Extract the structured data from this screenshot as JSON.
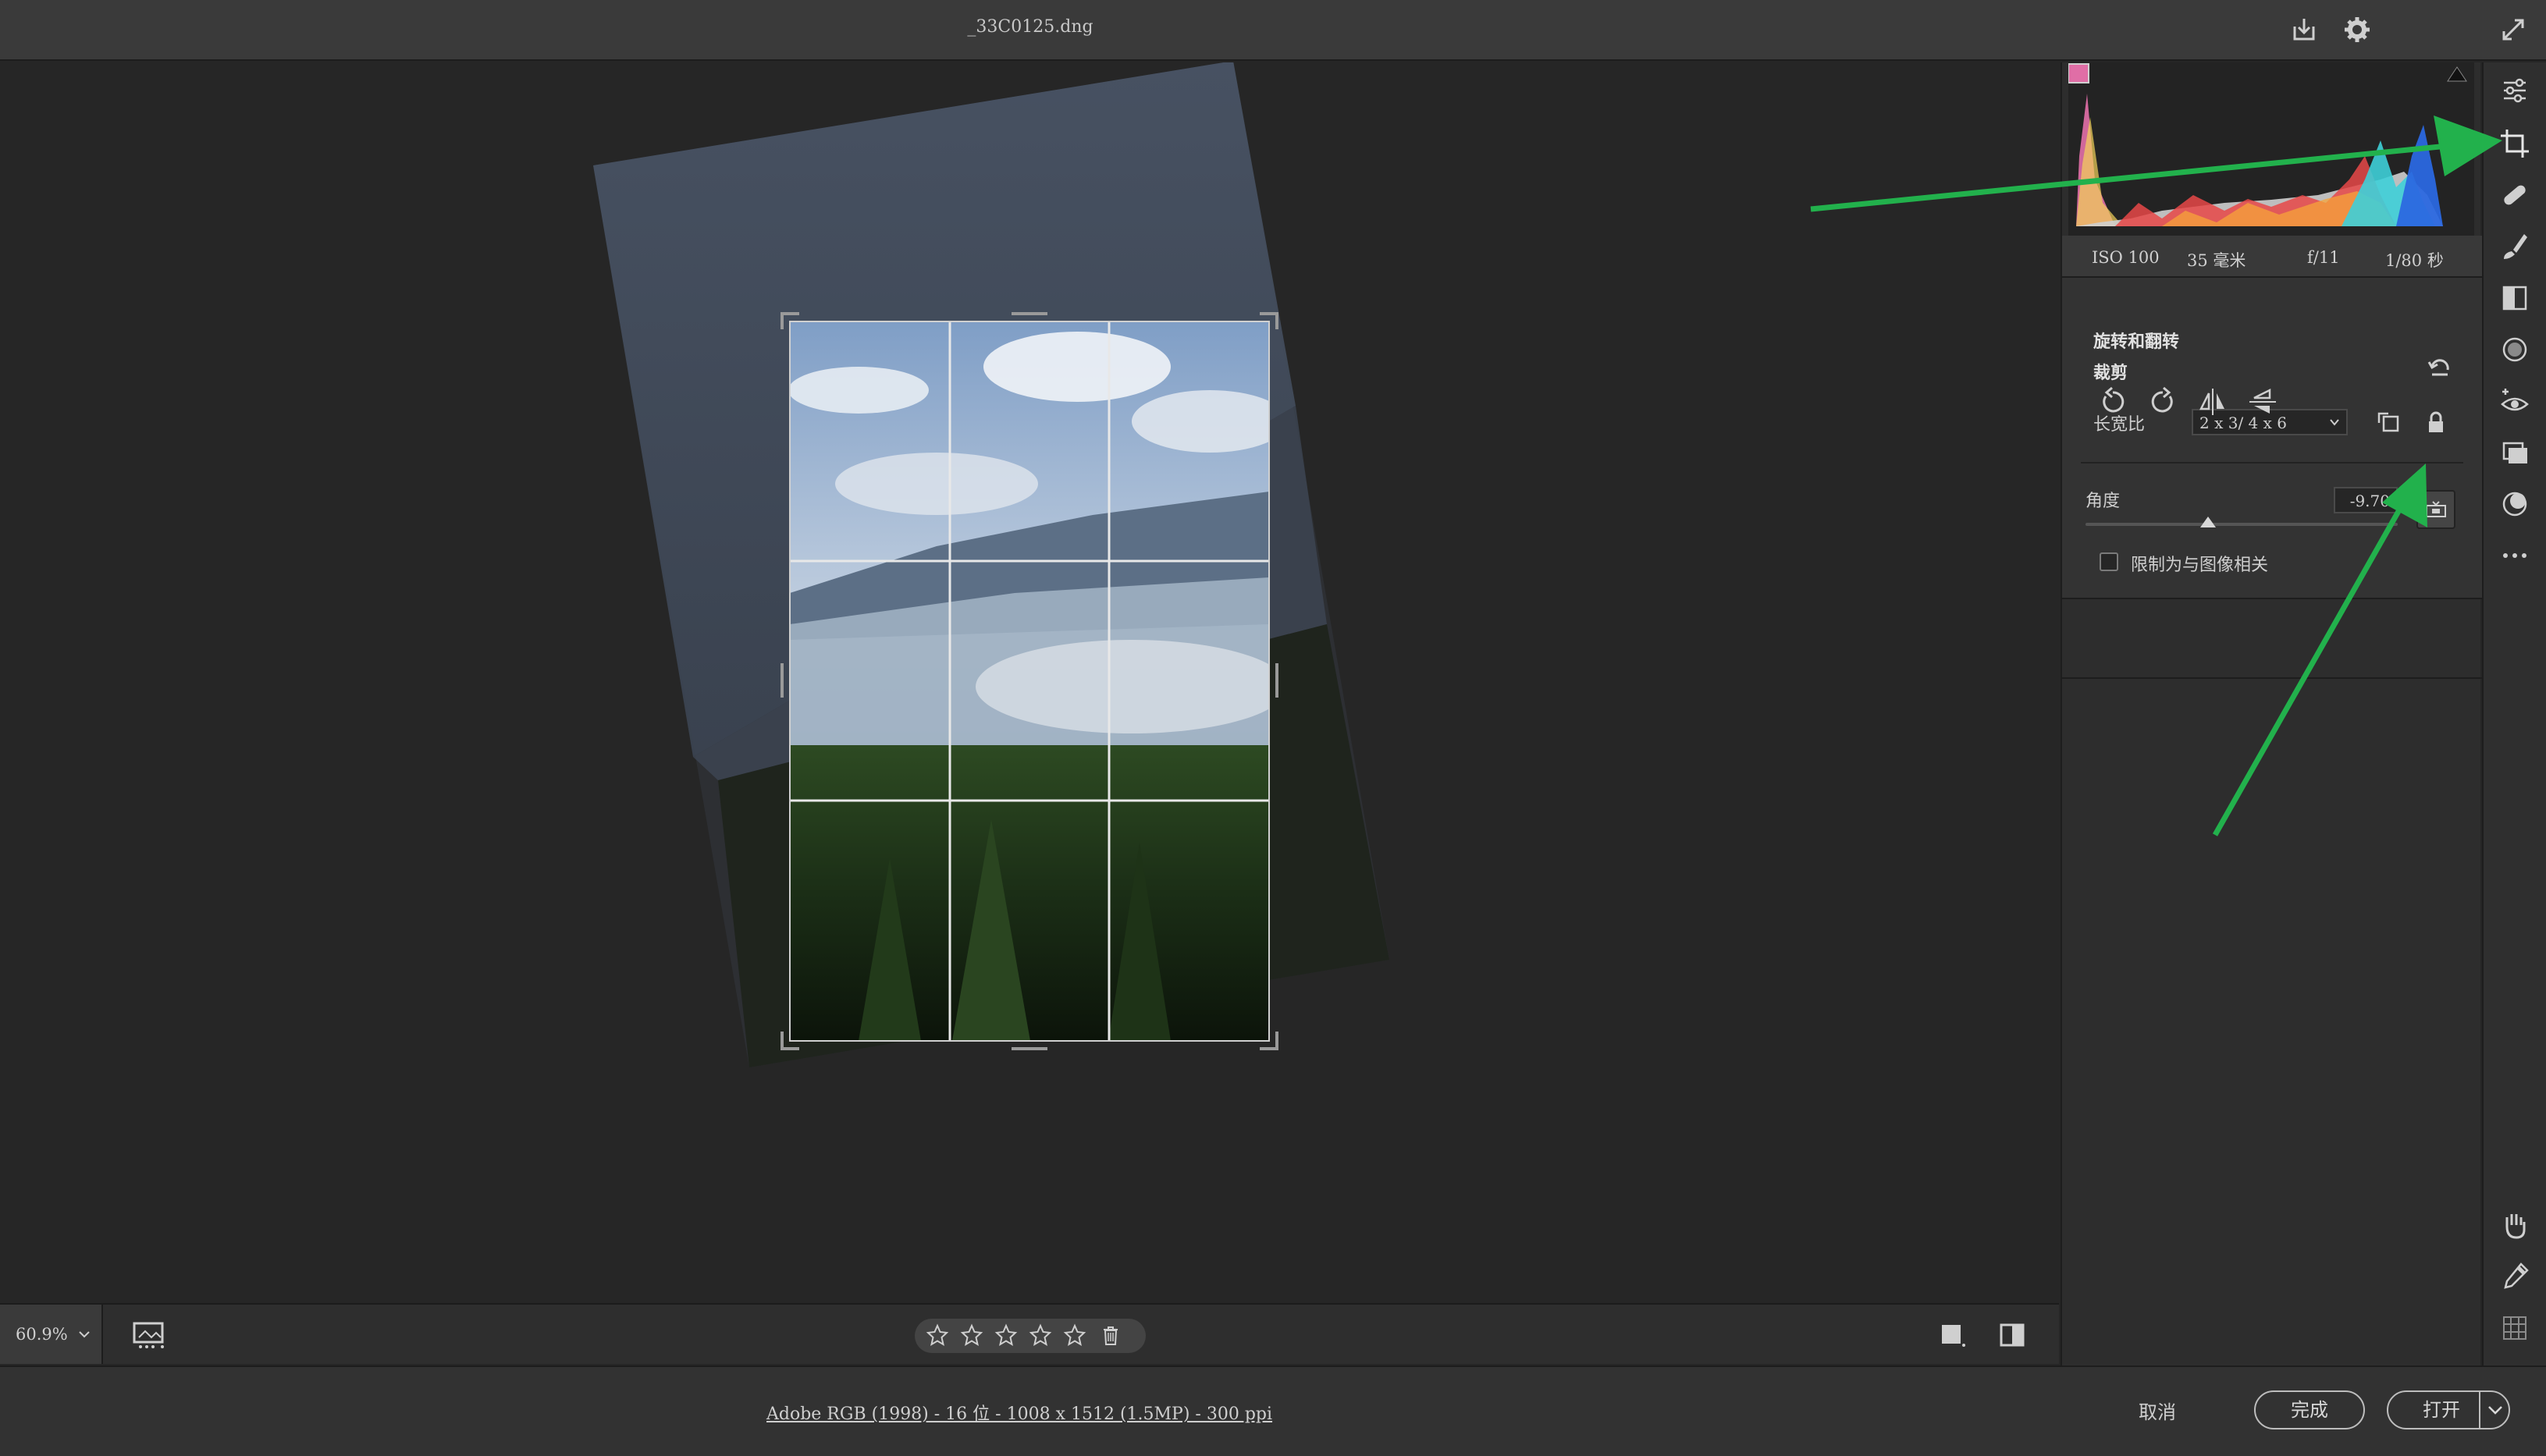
{
  "window": {
    "title": "_33C0125.dng"
  },
  "zoom": {
    "value": "60.9%"
  },
  "rating": {
    "stars": 0,
    "max": 5
  },
  "footer": {
    "workflow_link": "Adobe RGB (1998) - 16 位 - 1008 x 1512 (1.5MP) - 300 ppi",
    "cancel": "取消",
    "done": "完成",
    "open": "打开"
  },
  "exif": {
    "iso": "ISO 100",
    "focal": "35 毫米",
    "aperture": "f/11",
    "shutter": "1/80 秒"
  },
  "crop": {
    "title": "裁剪",
    "aspect_label": "长宽比",
    "aspect_value": "2 x 3/ 4 x 6",
    "angle_label": "角度",
    "angle_value": "-9.70",
    "constrain_label": "限制为与图像相关",
    "constrain_checked": false
  },
  "rotate": {
    "title": "旋转和翻转"
  },
  "colors": {
    "annotation_arrow": "#22b14c",
    "panel_bg": "#333333",
    "canvas_bg": "#262626"
  }
}
